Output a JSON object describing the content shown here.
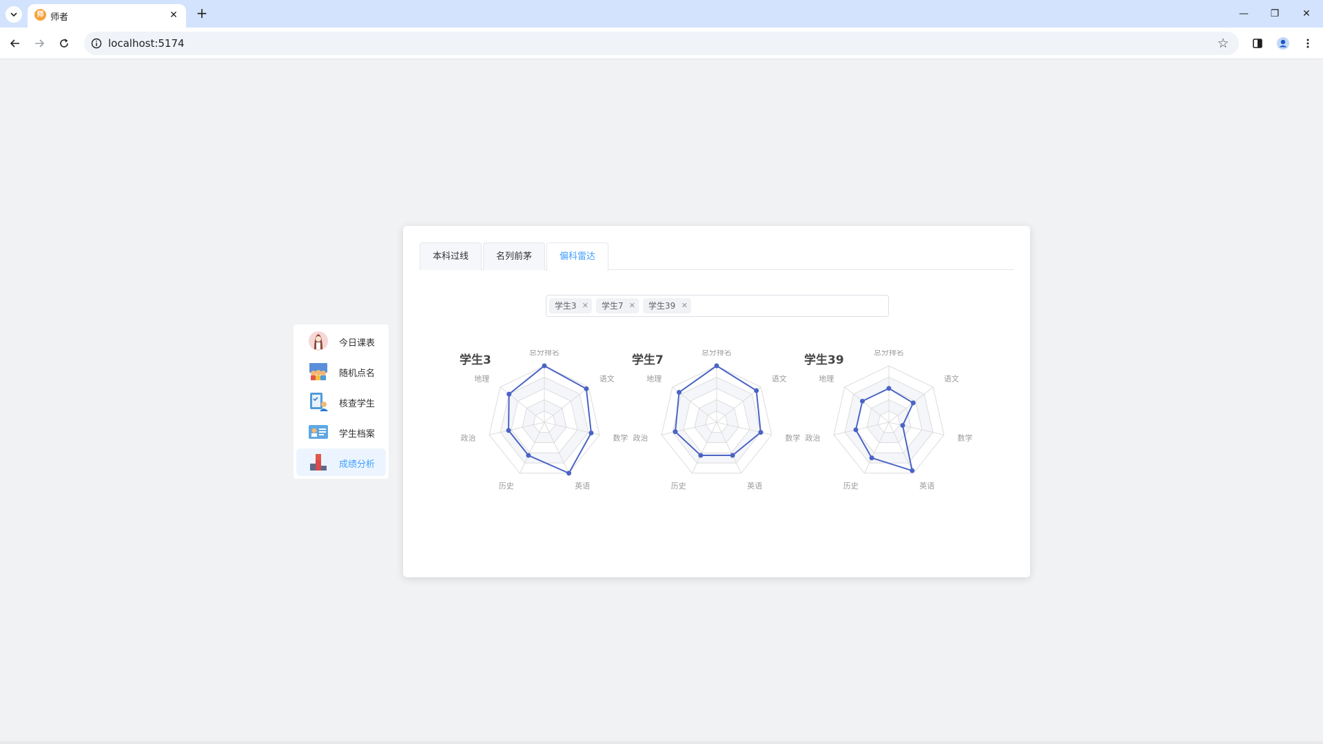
{
  "browser": {
    "tab_title": "师者",
    "tab_favicon_text": "师",
    "url": "localhost:5174"
  },
  "sidebar": {
    "items": [
      {
        "label": "今日课表",
        "icon": "teacher-avatar-icon",
        "active": false
      },
      {
        "label": "随机点名",
        "icon": "classroom-icon",
        "active": false
      },
      {
        "label": "核查学生",
        "icon": "checklist-icon",
        "active": false
      },
      {
        "label": "学生档案",
        "icon": "profile-card-icon",
        "active": false
      },
      {
        "label": "成绩分析",
        "icon": "podium-chart-icon",
        "active": true
      }
    ]
  },
  "main": {
    "tabs": [
      {
        "label": "本科过线",
        "active": false
      },
      {
        "label": "名列前茅",
        "active": false
      },
      {
        "label": "偏科雷达",
        "active": true
      }
    ],
    "selected_students": [
      "学生3",
      "学生7",
      "学生39"
    ]
  },
  "colors": {
    "accent": "#409eff",
    "radar_line": "#4a63c4",
    "menu_active_bg": "#ecf5ff"
  },
  "chart_data": [
    {
      "type": "radar",
      "title": "学生3",
      "indicators": [
        "总分排名",
        "语文",
        "数学",
        "英语",
        "历史",
        "政治",
        "地理"
      ],
      "values": [
        1.0,
        0.95,
        0.85,
        1.0,
        0.65,
        0.65,
        0.8
      ],
      "max": 1.0,
      "split_number": 5
    },
    {
      "type": "radar",
      "title": "学生7",
      "indicators": [
        "总分排名",
        "语文",
        "数学",
        "英语",
        "历史",
        "政治",
        "地理"
      ],
      "values": [
        1.0,
        0.9,
        0.8,
        0.65,
        0.65,
        0.75,
        0.85
      ],
      "max": 1.0,
      "split_number": 5
    },
    {
      "type": "radar",
      "title": "学生39",
      "indicators": [
        "总分排名",
        "语文",
        "数学",
        "英语",
        "历史",
        "政治",
        "地理"
      ],
      "values": [
        0.6,
        0.55,
        0.25,
        0.95,
        0.7,
        0.6,
        0.6
      ],
      "max": 1.0,
      "split_number": 5
    }
  ]
}
